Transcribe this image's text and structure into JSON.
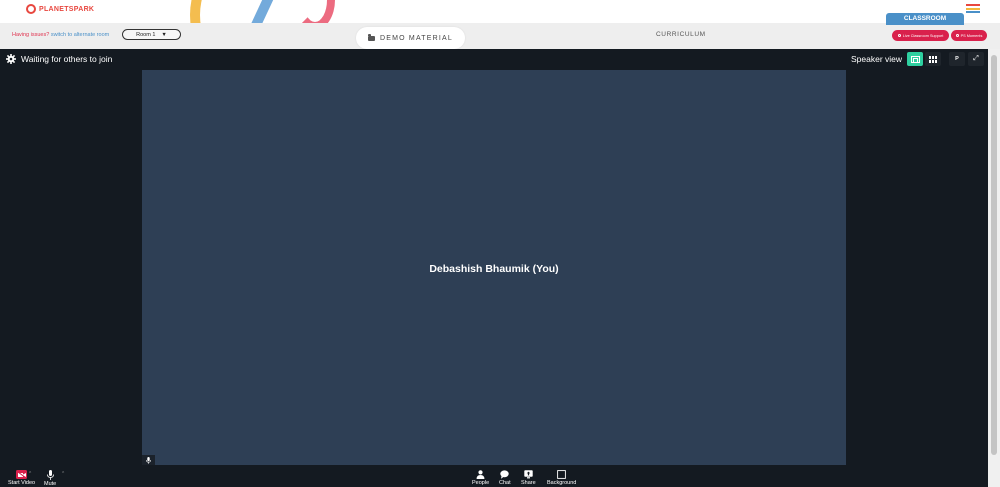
{
  "header": {
    "logo_text": "PLANETSPARK",
    "colors": {
      "brand": "#e8473f",
      "menu": [
        "#e8473f",
        "#f3b63c",
        "#4a90c8"
      ]
    }
  },
  "controls": {
    "issues_text": "Having issues?",
    "switch_link": "switch to alternate room",
    "room_selected": "Room 1",
    "demo_label": "DEMO MATERIAL",
    "curriculum_label": "CURRICULUM",
    "classroom_tab": "CLASSROOM",
    "support_pill": "Live Classroom Support",
    "moments_pill": "PS Moments"
  },
  "meeting": {
    "status_text": "Waiting for others to join",
    "view_label": "Speaker view",
    "p_label": "P",
    "participant_name": "Debashish Bhaumik (You)",
    "stage_color": "#2e3f55",
    "accent": "#2ed0a0"
  },
  "toolbar": {
    "items": [
      {
        "label": "Start Video",
        "icon": "camera-off-icon"
      },
      {
        "label": "Mute",
        "icon": "microphone-icon"
      },
      {
        "label": "People",
        "icon": "people-icon"
      },
      {
        "label": "Chat",
        "icon": "chat-icon"
      },
      {
        "label": "Share",
        "icon": "share-screen-icon"
      },
      {
        "label": "Background",
        "icon": "background-icon"
      }
    ]
  }
}
